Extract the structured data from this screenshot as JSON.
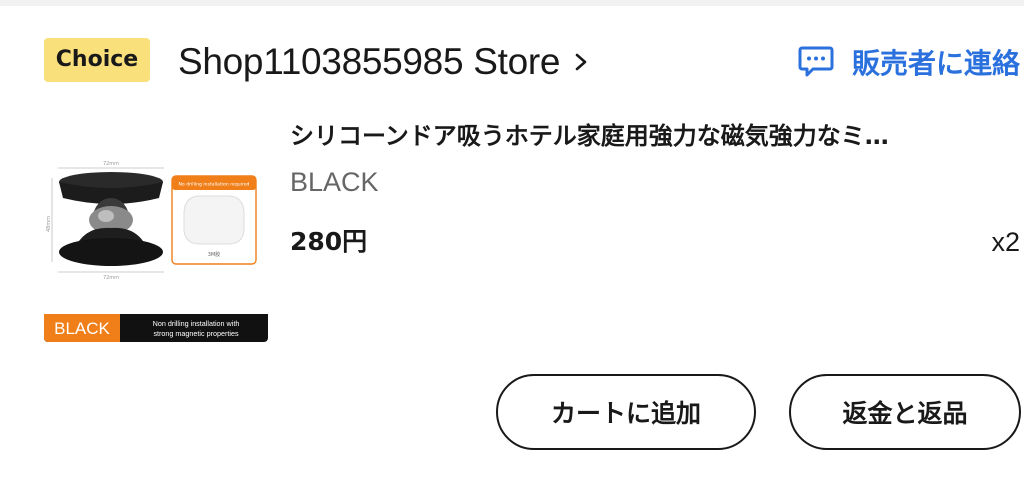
{
  "store": {
    "badge": "Choice",
    "name": "Shop1103855985 Store",
    "contact_label": "販売者に連絡"
  },
  "product": {
    "title": "シリコーンドア吸うホテル家庭用強力な磁気強力なミ…",
    "sku": "BLACK",
    "price": "280円",
    "quantity": "x2",
    "image": {
      "dimension_top": "72mm",
      "dimension_side": "48mm",
      "dimension_bottom": "72mm",
      "note_header": "No drilling installation required",
      "adhesive_label": "3M胶",
      "color_label": "BLACK",
      "caption_line1": "Non drilling installation with",
      "caption_line2": "strong magnetic properties"
    }
  },
  "actions": {
    "add_to_cart": "カートに追加",
    "refund": "返金と返品"
  },
  "colors": {
    "choice_badge": "#f9e07a",
    "link_blue": "#2b71de",
    "image_orange": "#f07f1a"
  }
}
